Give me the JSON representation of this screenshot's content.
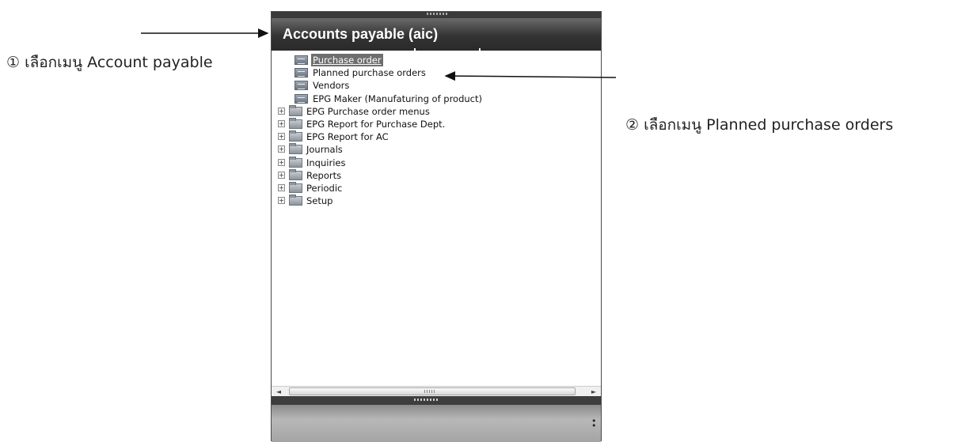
{
  "annotations": {
    "step1": "① เลือกเมนู Account payable",
    "step2": "② เลือกเมนู Planned purchase orders"
  },
  "window": {
    "title": "Accounts payable (aic)"
  },
  "tree": {
    "items": [
      {
        "label": "Purchase order",
        "type": "form",
        "expandable": false,
        "selected": true
      },
      {
        "label": "Planned purchase orders",
        "type": "form",
        "expandable": false,
        "selected": false
      },
      {
        "label": "Vendors",
        "type": "form",
        "expandable": false,
        "selected": false
      },
      {
        "label": "EPG Maker (Manufaturing  of product)",
        "type": "form",
        "expandable": false,
        "selected": false
      },
      {
        "label": "EPG Purchase order menus",
        "type": "folder",
        "expandable": true,
        "selected": false
      },
      {
        "label": "EPG Report for Purchase Dept.",
        "type": "folder",
        "expandable": true,
        "selected": false
      },
      {
        "label": "EPG Report for AC",
        "type": "folder",
        "expandable": true,
        "selected": false
      },
      {
        "label": "Journals",
        "type": "folder",
        "expandable": true,
        "selected": false
      },
      {
        "label": "Inquiries",
        "type": "folder",
        "expandable": true,
        "selected": false
      },
      {
        "label": "Reports",
        "type": "folder",
        "expandable": true,
        "selected": false
      },
      {
        "label": "Periodic",
        "type": "folder",
        "expandable": true,
        "selected": false
      },
      {
        "label": "Setup",
        "type": "folder",
        "expandable": true,
        "selected": false
      }
    ],
    "expander_symbol": "+"
  },
  "scrollbar": {
    "left_arrow": "◄",
    "right_arrow": "►"
  },
  "icons": {
    "form": "form-icon",
    "folder": "folder-icon",
    "more": "more-options-icon"
  },
  "colors": {
    "title_bar": "#333333",
    "selection": "#6e6e6e",
    "annotation_text": "#222222",
    "arrow": "#111111"
  }
}
